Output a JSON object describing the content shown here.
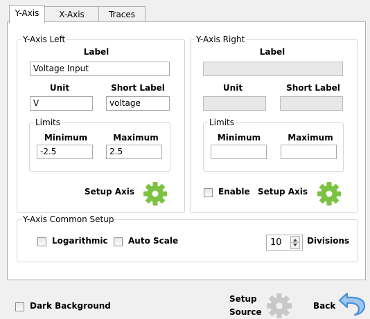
{
  "tabs": [
    {
      "label": "Y-Axis",
      "active": true
    },
    {
      "label": "X-Axis",
      "active": false
    },
    {
      "label": "Traces",
      "active": false
    }
  ],
  "left": {
    "title": "Y-Axis Left",
    "label_heading": "Label",
    "label_value": "Voltage Input",
    "unit_heading": "Unit",
    "unit_value": "V",
    "short_heading": "Short Label",
    "short_value": "voltage",
    "limits_title": "Limits",
    "min_heading": "Minimum",
    "min_value": "-2.5",
    "max_heading": "Maximum",
    "max_value": "2.5",
    "setup_axis": "Setup Axis",
    "gear_icon": "gear-icon"
  },
  "right": {
    "title": "Y-Axis Right",
    "label_heading": "Label",
    "label_value": "",
    "unit_heading": "Unit",
    "unit_value": "",
    "short_heading": "Short Label",
    "short_value": "",
    "limits_title": "Limits",
    "min_heading": "Minimum",
    "min_value": "",
    "max_heading": "Maximum",
    "max_value": "",
    "enable_label": "Enable",
    "setup_axis": "Setup Axis",
    "gear_icon": "gear-icon"
  },
  "common": {
    "title": "Y-Axis Common Setup",
    "logarithmic": "Logarithmic",
    "auto_scale": "Auto Scale",
    "divisions_value": "10",
    "divisions_label": "Divisions"
  },
  "footer": {
    "dark_background": "Dark Background",
    "setup_source_line1": "Setup",
    "setup_source_line2": "Source",
    "back": "Back"
  },
  "colors": {
    "gear_active": "#7cc242",
    "gear_disabled": "#c8c8c8",
    "back_arrow": "#4a8fd8"
  }
}
